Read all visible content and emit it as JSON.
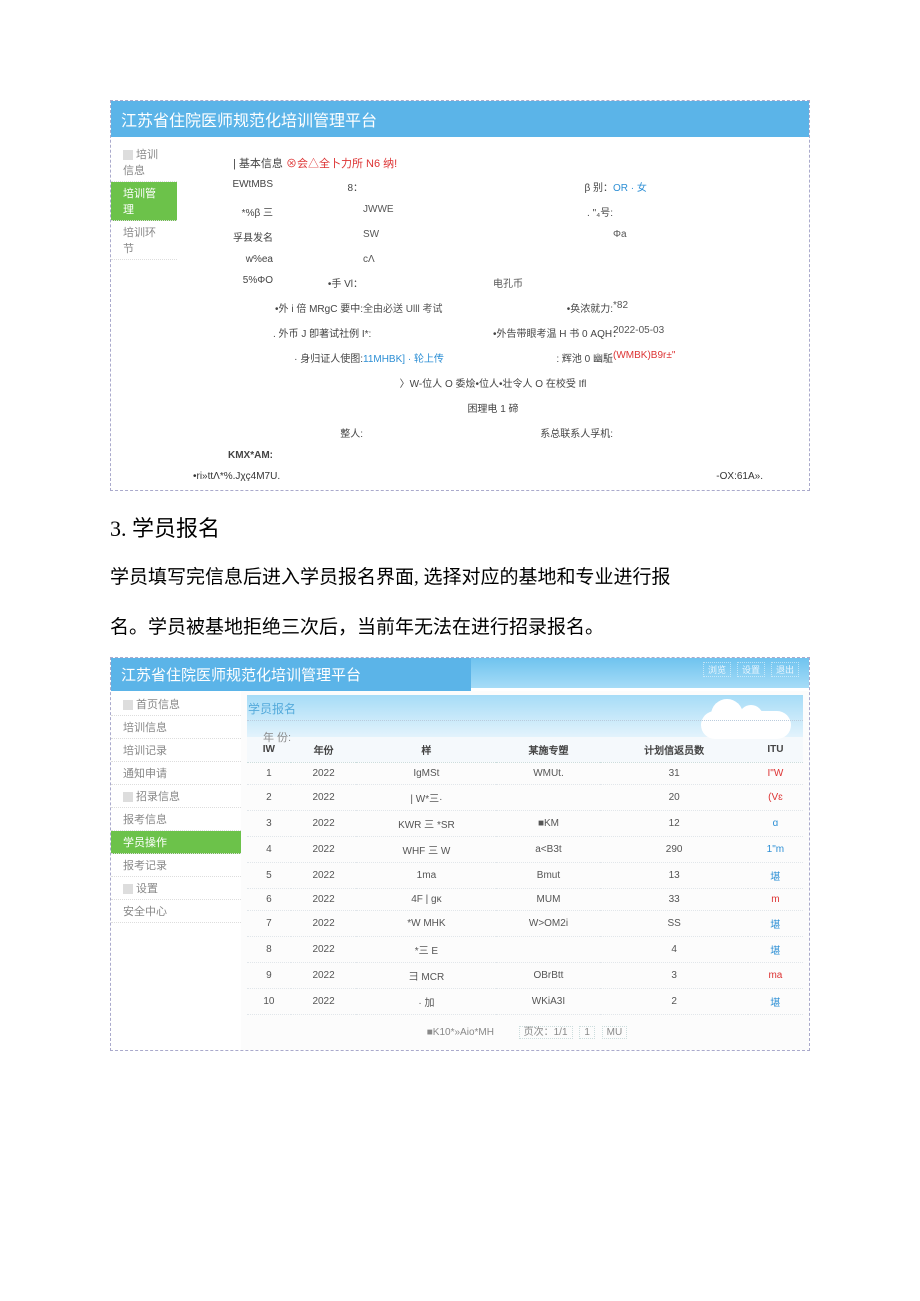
{
  "doc": {
    "heading": "3. 学员报名",
    "para1": "学员填写完信息后进入学员报名界面, 选择对应的基地和专业进行报",
    "para2": "名。学员被基地拒绝三次后，当前年无法在进行招录报名。"
  },
  "shot1": {
    "title": "江苏省住院医师规范化培训管理平台",
    "sidebar": {
      "cat": "培训信息",
      "active": "培训管理",
      "sub": "培训环节"
    },
    "formTitle_a": "| 基本信息 ",
    "formTitle_b": "⊗会",
    "formTitle_c": "△全卜力所 N6 纳!",
    "rows": {
      "a1": "ΕWtMBS",
      "a2": "8：",
      "a4": "β 别：",
      "a5": "OR · 女",
      "b1": "*%β 三",
      "b3": "JWWE",
      "b4": ". \"₄号:",
      "c1": "孚县发名",
      "c3": "SW",
      "c5": "Φa",
      "d1": "w%ea",
      "d3": "cΛ",
      "e1": "5%ΦO",
      "e2": "•手 Vl：",
      "e4": "电孔币",
      "f2": "•外 i 倍 MRgC 要中:",
      "f3": "全由必送 Ulll 考试",
      "f4": "•奂浓就力:",
      "f5": "*82",
      "g2": ". 外币 J 卽著试社例 I*:",
      "g4": "•外告带眼考温 H 书 0 AQH：",
      "g5": "2022-05-03",
      "h2": "· 身归证人使图:",
      "h3": "11MHBK] · 轮上传",
      "h4": ": 辉池 0 幽駈",
      "h5": "(WMBK)B9r±\"",
      "i_center": "〉W-位人 O 委烩•位人•壮令人 O 在校受 Ifl",
      "j_center": "困理电 1 碲",
      "k2": "整人:",
      "k4": "系总联系人孚机:",
      "l1": "KMX*AM:",
      "m1": "•ri»ttΛ*%.Jχç4M7U.",
      "m4": "-OX:61A»."
    }
  },
  "shot2": {
    "title": "江苏省住院医师规范化培训管理平台",
    "tabs": [
      "浏览",
      "设置",
      "退出"
    ],
    "sidebar": {
      "groups": [
        {
          "head": "首页信息",
          "items": [
            "培训信息",
            "培训记录",
            "通知申请"
          ]
        },
        {
          "head": "招录信息",
          "items": [
            "报考信息"
          ]
        },
        {
          "active": "学员操作",
          "items": [
            "报考记录"
          ]
        },
        {
          "head": "设置",
          "items": [
            "安全中心"
          ]
        }
      ]
    },
    "section": "学员报名",
    "yearLabel": "年    份:",
    "headers": [
      "IW",
      "年份",
      "样",
      "某施专塑",
      "计划信返员数",
      "ITU"
    ],
    "rows": [
      {
        "n": "1",
        "y": "2022",
        "c": "IgMSt",
        "d": "WMUt.",
        "e": "31",
        "op": "I\"W",
        "cls": "red"
      },
      {
        "n": "2",
        "y": "2022",
        "c": "| W*三·",
        "d": "",
        "e": "20",
        "op": "(Vɛ",
        "cls": "red"
      },
      {
        "n": "3",
        "y": "2022",
        "c": "KWR 三 *SR",
        "d": "■KM",
        "e": "12",
        "op": "ɑ",
        "cls": ""
      },
      {
        "n": "4",
        "y": "2022",
        "c": "WHF 三 W",
        "d": "a<B3t",
        "e": "290",
        "op": "1\"m",
        "cls": ""
      },
      {
        "n": "5",
        "y": "2022",
        "c": "1ma",
        "d": "Bmut",
        "e": "13",
        "op": "堪",
        "cls": ""
      },
      {
        "n": "6",
        "y": "2022",
        "c": "4F | gκ",
        "d": "MUM",
        "e": "33",
        "op": "m",
        "cls": "red"
      },
      {
        "n": "7",
        "y": "2022",
        "c": "*W     MHK",
        "d": "W>OM2i",
        "e": "SS",
        "op": "堪",
        "cls": ""
      },
      {
        "n": "8",
        "y": "2022",
        "c": "*三 E",
        "d": "",
        "e": "4",
        "op": "堪",
        "cls": ""
      },
      {
        "n": "9",
        "y": "2022",
        "c": "彐 MCR",
        "d": "OBrBtt",
        "e": "3",
        "op": "ma",
        "cls": "red"
      },
      {
        "n": "10",
        "y": "2022",
        "c": "· 加",
        "d": "WKiA3I",
        "e": "2",
        "op": "堪",
        "cls": ""
      }
    ],
    "footerLeft": "■K10*»Aio*MH",
    "pager": {
      "a": "页次：1/1",
      "b": "1",
      "c": "MU"
    }
  }
}
